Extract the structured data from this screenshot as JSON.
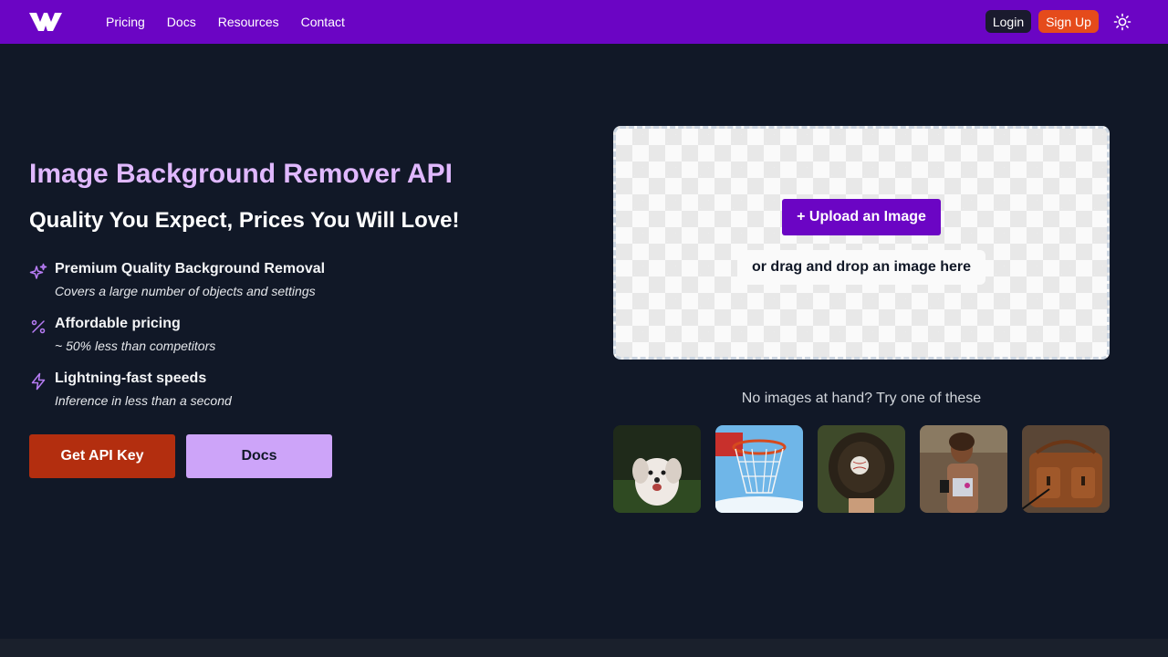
{
  "header": {
    "logo_icon": "w-logo-icon",
    "nav": [
      "Pricing",
      "Docs",
      "Resources",
      "Contact"
    ],
    "login_label": "Login",
    "signup_label": "Sign Up",
    "theme_icon": "sun-icon"
  },
  "hero": {
    "title": "Image Background Remover API",
    "subtitle": "Quality You Expect, Prices You Will Love!",
    "features": [
      {
        "icon": "sparkles-icon",
        "title": "Premium Quality Background Removal",
        "desc": "Covers a large number of objects and settings"
      },
      {
        "icon": "percent-icon",
        "title": "Affordable pricing",
        "desc": "~ 50% less than competitors"
      },
      {
        "icon": "lightning-icon",
        "title": "Lightning-fast speeds",
        "desc": "Inference in less than a second"
      }
    ],
    "api_button": "Get API Key",
    "docs_button": "Docs"
  },
  "upload": {
    "button": "+ Upload an Image",
    "drop_hint": "or drag and drop an image here",
    "sample_prompt": "No images at hand? Try one of these",
    "samples": [
      "sample-dog",
      "sample-basketball-hoop",
      "sample-baseball-glove",
      "sample-runner",
      "sample-leather-bag"
    ]
  },
  "colors": {
    "brand": "#6b05c4",
    "accent": "#e0b8ff",
    "cta": "#b32e0f",
    "signup": "#e54b1b",
    "background": "#111827"
  }
}
